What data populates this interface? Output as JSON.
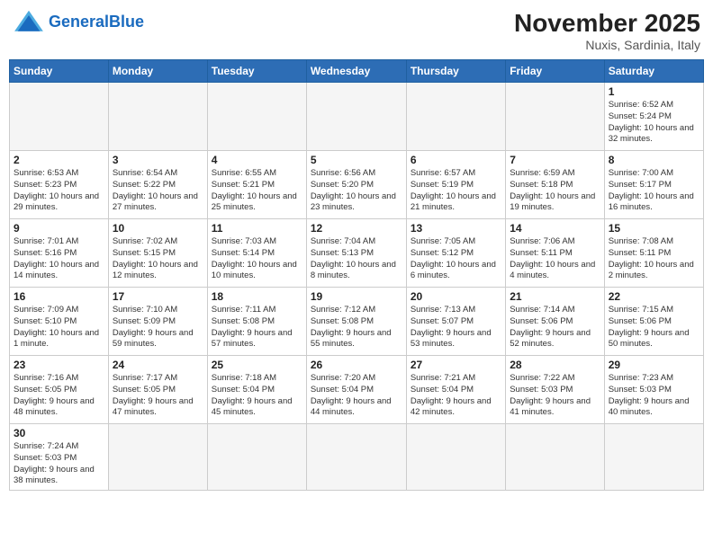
{
  "header": {
    "logo_general": "General",
    "logo_blue": "Blue",
    "month_title": "November 2025",
    "location": "Nuxis, Sardinia, Italy"
  },
  "weekdays": [
    "Sunday",
    "Monday",
    "Tuesday",
    "Wednesday",
    "Thursday",
    "Friday",
    "Saturday"
  ],
  "weeks": [
    [
      {
        "day": "",
        "info": ""
      },
      {
        "day": "",
        "info": ""
      },
      {
        "day": "",
        "info": ""
      },
      {
        "day": "",
        "info": ""
      },
      {
        "day": "",
        "info": ""
      },
      {
        "day": "",
        "info": ""
      },
      {
        "day": "1",
        "info": "Sunrise: 6:52 AM\nSunset: 5:24 PM\nDaylight: 10 hours and 32 minutes."
      }
    ],
    [
      {
        "day": "2",
        "info": "Sunrise: 6:53 AM\nSunset: 5:23 PM\nDaylight: 10 hours and 29 minutes."
      },
      {
        "day": "3",
        "info": "Sunrise: 6:54 AM\nSunset: 5:22 PM\nDaylight: 10 hours and 27 minutes."
      },
      {
        "day": "4",
        "info": "Sunrise: 6:55 AM\nSunset: 5:21 PM\nDaylight: 10 hours and 25 minutes."
      },
      {
        "day": "5",
        "info": "Sunrise: 6:56 AM\nSunset: 5:20 PM\nDaylight: 10 hours and 23 minutes."
      },
      {
        "day": "6",
        "info": "Sunrise: 6:57 AM\nSunset: 5:19 PM\nDaylight: 10 hours and 21 minutes."
      },
      {
        "day": "7",
        "info": "Sunrise: 6:59 AM\nSunset: 5:18 PM\nDaylight: 10 hours and 19 minutes."
      },
      {
        "day": "8",
        "info": "Sunrise: 7:00 AM\nSunset: 5:17 PM\nDaylight: 10 hours and 16 minutes."
      }
    ],
    [
      {
        "day": "9",
        "info": "Sunrise: 7:01 AM\nSunset: 5:16 PM\nDaylight: 10 hours and 14 minutes."
      },
      {
        "day": "10",
        "info": "Sunrise: 7:02 AM\nSunset: 5:15 PM\nDaylight: 10 hours and 12 minutes."
      },
      {
        "day": "11",
        "info": "Sunrise: 7:03 AM\nSunset: 5:14 PM\nDaylight: 10 hours and 10 minutes."
      },
      {
        "day": "12",
        "info": "Sunrise: 7:04 AM\nSunset: 5:13 PM\nDaylight: 10 hours and 8 minutes."
      },
      {
        "day": "13",
        "info": "Sunrise: 7:05 AM\nSunset: 5:12 PM\nDaylight: 10 hours and 6 minutes."
      },
      {
        "day": "14",
        "info": "Sunrise: 7:06 AM\nSunset: 5:11 PM\nDaylight: 10 hours and 4 minutes."
      },
      {
        "day": "15",
        "info": "Sunrise: 7:08 AM\nSunset: 5:11 PM\nDaylight: 10 hours and 2 minutes."
      }
    ],
    [
      {
        "day": "16",
        "info": "Sunrise: 7:09 AM\nSunset: 5:10 PM\nDaylight: 10 hours and 1 minute."
      },
      {
        "day": "17",
        "info": "Sunrise: 7:10 AM\nSunset: 5:09 PM\nDaylight: 9 hours and 59 minutes."
      },
      {
        "day": "18",
        "info": "Sunrise: 7:11 AM\nSunset: 5:08 PM\nDaylight: 9 hours and 57 minutes."
      },
      {
        "day": "19",
        "info": "Sunrise: 7:12 AM\nSunset: 5:08 PM\nDaylight: 9 hours and 55 minutes."
      },
      {
        "day": "20",
        "info": "Sunrise: 7:13 AM\nSunset: 5:07 PM\nDaylight: 9 hours and 53 minutes."
      },
      {
        "day": "21",
        "info": "Sunrise: 7:14 AM\nSunset: 5:06 PM\nDaylight: 9 hours and 52 minutes."
      },
      {
        "day": "22",
        "info": "Sunrise: 7:15 AM\nSunset: 5:06 PM\nDaylight: 9 hours and 50 minutes."
      }
    ],
    [
      {
        "day": "23",
        "info": "Sunrise: 7:16 AM\nSunset: 5:05 PM\nDaylight: 9 hours and 48 minutes."
      },
      {
        "day": "24",
        "info": "Sunrise: 7:17 AM\nSunset: 5:05 PM\nDaylight: 9 hours and 47 minutes."
      },
      {
        "day": "25",
        "info": "Sunrise: 7:18 AM\nSunset: 5:04 PM\nDaylight: 9 hours and 45 minutes."
      },
      {
        "day": "26",
        "info": "Sunrise: 7:20 AM\nSunset: 5:04 PM\nDaylight: 9 hours and 44 minutes."
      },
      {
        "day": "27",
        "info": "Sunrise: 7:21 AM\nSunset: 5:04 PM\nDaylight: 9 hours and 42 minutes."
      },
      {
        "day": "28",
        "info": "Sunrise: 7:22 AM\nSunset: 5:03 PM\nDaylight: 9 hours and 41 minutes."
      },
      {
        "day": "29",
        "info": "Sunrise: 7:23 AM\nSunset: 5:03 PM\nDaylight: 9 hours and 40 minutes."
      }
    ],
    [
      {
        "day": "30",
        "info": "Sunrise: 7:24 AM\nSunset: 5:03 PM\nDaylight: 9 hours and 38 minutes."
      },
      {
        "day": "",
        "info": ""
      },
      {
        "day": "",
        "info": ""
      },
      {
        "day": "",
        "info": ""
      },
      {
        "day": "",
        "info": ""
      },
      {
        "day": "",
        "info": ""
      },
      {
        "day": "",
        "info": ""
      }
    ]
  ]
}
